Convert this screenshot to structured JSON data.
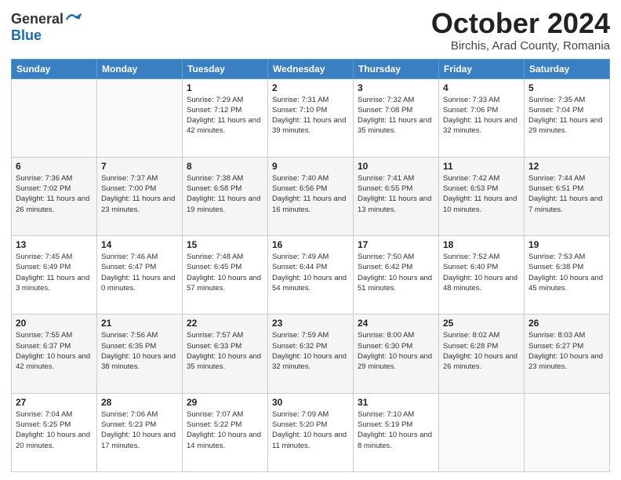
{
  "header": {
    "title": "October 2024",
    "location": "Birchis, Arad County, Romania"
  },
  "calendar": {
    "headers": [
      "Sunday",
      "Monday",
      "Tuesday",
      "Wednesday",
      "Thursday",
      "Friday",
      "Saturday"
    ],
    "weeks": [
      [
        {
          "day": "",
          "info": ""
        },
        {
          "day": "",
          "info": ""
        },
        {
          "day": "1",
          "info": "Sunrise: 7:29 AM\nSunset: 7:12 PM\nDaylight: 11 hours and 42 minutes."
        },
        {
          "day": "2",
          "info": "Sunrise: 7:31 AM\nSunset: 7:10 PM\nDaylight: 11 hours and 39 minutes."
        },
        {
          "day": "3",
          "info": "Sunrise: 7:32 AM\nSunset: 7:08 PM\nDaylight: 11 hours and 35 minutes."
        },
        {
          "day": "4",
          "info": "Sunrise: 7:33 AM\nSunset: 7:06 PM\nDaylight: 11 hours and 32 minutes."
        },
        {
          "day": "5",
          "info": "Sunrise: 7:35 AM\nSunset: 7:04 PM\nDaylight: 11 hours and 29 minutes."
        }
      ],
      [
        {
          "day": "6",
          "info": "Sunrise: 7:36 AM\nSunset: 7:02 PM\nDaylight: 11 hours and 26 minutes."
        },
        {
          "day": "7",
          "info": "Sunrise: 7:37 AM\nSunset: 7:00 PM\nDaylight: 11 hours and 23 minutes."
        },
        {
          "day": "8",
          "info": "Sunrise: 7:38 AM\nSunset: 6:58 PM\nDaylight: 11 hours and 19 minutes."
        },
        {
          "day": "9",
          "info": "Sunrise: 7:40 AM\nSunset: 6:56 PM\nDaylight: 11 hours and 16 minutes."
        },
        {
          "day": "10",
          "info": "Sunrise: 7:41 AM\nSunset: 6:55 PM\nDaylight: 11 hours and 13 minutes."
        },
        {
          "day": "11",
          "info": "Sunrise: 7:42 AM\nSunset: 6:53 PM\nDaylight: 11 hours and 10 minutes."
        },
        {
          "day": "12",
          "info": "Sunrise: 7:44 AM\nSunset: 6:51 PM\nDaylight: 11 hours and 7 minutes."
        }
      ],
      [
        {
          "day": "13",
          "info": "Sunrise: 7:45 AM\nSunset: 6:49 PM\nDaylight: 11 hours and 3 minutes."
        },
        {
          "day": "14",
          "info": "Sunrise: 7:46 AM\nSunset: 6:47 PM\nDaylight: 11 hours and 0 minutes."
        },
        {
          "day": "15",
          "info": "Sunrise: 7:48 AM\nSunset: 6:45 PM\nDaylight: 10 hours and 57 minutes."
        },
        {
          "day": "16",
          "info": "Sunrise: 7:49 AM\nSunset: 6:44 PM\nDaylight: 10 hours and 54 minutes."
        },
        {
          "day": "17",
          "info": "Sunrise: 7:50 AM\nSunset: 6:42 PM\nDaylight: 10 hours and 51 minutes."
        },
        {
          "day": "18",
          "info": "Sunrise: 7:52 AM\nSunset: 6:40 PM\nDaylight: 10 hours and 48 minutes."
        },
        {
          "day": "19",
          "info": "Sunrise: 7:53 AM\nSunset: 6:38 PM\nDaylight: 10 hours and 45 minutes."
        }
      ],
      [
        {
          "day": "20",
          "info": "Sunrise: 7:55 AM\nSunset: 6:37 PM\nDaylight: 10 hours and 42 minutes."
        },
        {
          "day": "21",
          "info": "Sunrise: 7:56 AM\nSunset: 6:35 PM\nDaylight: 10 hours and 38 minutes."
        },
        {
          "day": "22",
          "info": "Sunrise: 7:57 AM\nSunset: 6:33 PM\nDaylight: 10 hours and 35 minutes."
        },
        {
          "day": "23",
          "info": "Sunrise: 7:59 AM\nSunset: 6:32 PM\nDaylight: 10 hours and 32 minutes."
        },
        {
          "day": "24",
          "info": "Sunrise: 8:00 AM\nSunset: 6:30 PM\nDaylight: 10 hours and 29 minutes."
        },
        {
          "day": "25",
          "info": "Sunrise: 8:02 AM\nSunset: 6:28 PM\nDaylight: 10 hours and 26 minutes."
        },
        {
          "day": "26",
          "info": "Sunrise: 8:03 AM\nSunset: 6:27 PM\nDaylight: 10 hours and 23 minutes."
        }
      ],
      [
        {
          "day": "27",
          "info": "Sunrise: 7:04 AM\nSunset: 5:25 PM\nDaylight: 10 hours and 20 minutes."
        },
        {
          "day": "28",
          "info": "Sunrise: 7:06 AM\nSunset: 5:23 PM\nDaylight: 10 hours and 17 minutes."
        },
        {
          "day": "29",
          "info": "Sunrise: 7:07 AM\nSunset: 5:22 PM\nDaylight: 10 hours and 14 minutes."
        },
        {
          "day": "30",
          "info": "Sunrise: 7:09 AM\nSunset: 5:20 PM\nDaylight: 10 hours and 11 minutes."
        },
        {
          "day": "31",
          "info": "Sunrise: 7:10 AM\nSunset: 5:19 PM\nDaylight: 10 hours and 8 minutes."
        },
        {
          "day": "",
          "info": ""
        },
        {
          "day": "",
          "info": ""
        }
      ]
    ]
  }
}
